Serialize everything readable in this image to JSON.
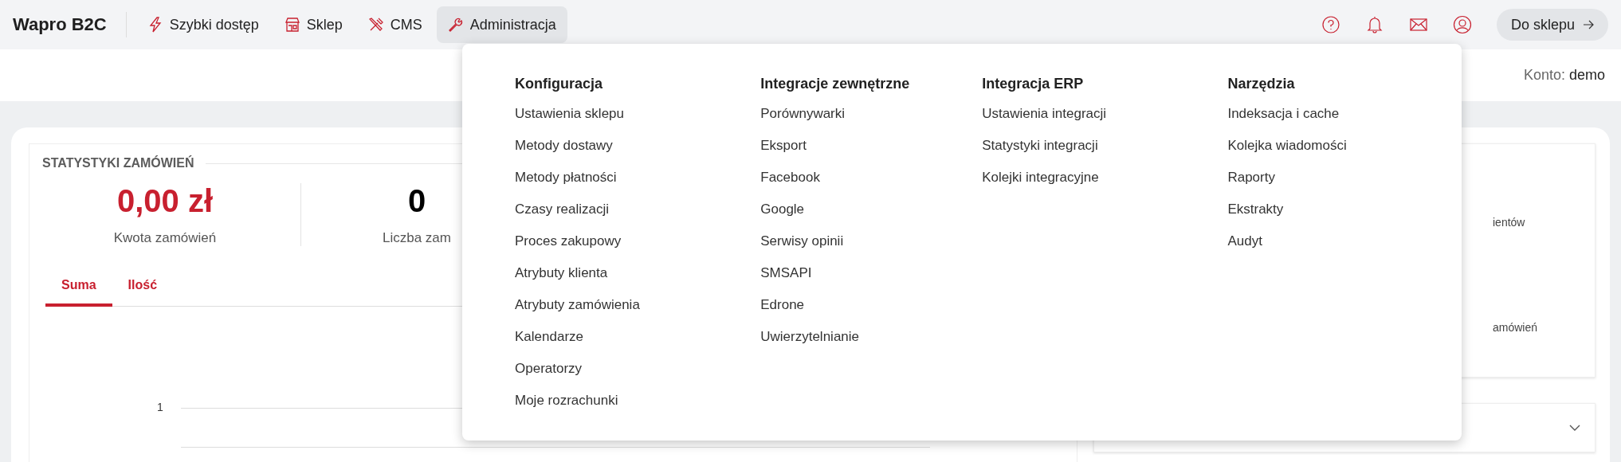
{
  "topbar": {
    "logo": "Wapro B2C",
    "nav": [
      {
        "label": "Szybki dostęp",
        "selected": false
      },
      {
        "label": "Sklep",
        "selected": false
      },
      {
        "label": "CMS",
        "selected": false
      },
      {
        "label": "Administracja",
        "selected": true
      }
    ],
    "shop_button": "Do sklepu"
  },
  "subheader": {
    "account_label": "Konto:",
    "account_value": "demo"
  },
  "order_stats": {
    "title": "STATYSTYKI ZAMÓWIEŃ",
    "metrics": [
      {
        "kind": "money",
        "value": "0,00 zł",
        "label": "Kwota zamówień"
      },
      {
        "kind": "count",
        "value": "0",
        "label": "Liczba zam"
      }
    ],
    "tabs": [
      {
        "label": "Suma",
        "selected": true
      },
      {
        "label": "Ilość",
        "selected": false
      }
    ],
    "chart": {
      "ytick": "1"
    }
  },
  "side_panel": {
    "fragments": [
      "ientów",
      "amówień"
    ],
    "accordion": {
      "expanded": false
    }
  },
  "dropdown": {
    "columns": [
      {
        "heading": "Konfiguracja",
        "items": [
          "Ustawienia sklepu",
          "Metody dostawy",
          "Metody płatności",
          "Czasy realizacji",
          "Proces zakupowy",
          "Atrybuty klienta",
          "Atrybuty zamówienia",
          "Kalendarze",
          "Operatorzy",
          "Moje rozrachunki"
        ]
      },
      {
        "heading": "Integracje zewnętrzne",
        "items": [
          "Porównywarki",
          "Eksport",
          "Facebook",
          "Google",
          "Serwisy opinii",
          "SMSAPI",
          "Edrone",
          "Uwierzytelnianie"
        ]
      },
      {
        "heading": "Integracja ERP",
        "items": [
          "Ustawienia integracji",
          "Statystyki integracji",
          "Kolejki integracyjne"
        ]
      },
      {
        "heading": "Narzędzia",
        "items": [
          "Indeksacja i cache",
          "Kolejka wiadomości",
          "Raporty",
          "Ekstrakty",
          "Audyt"
        ]
      }
    ]
  }
}
